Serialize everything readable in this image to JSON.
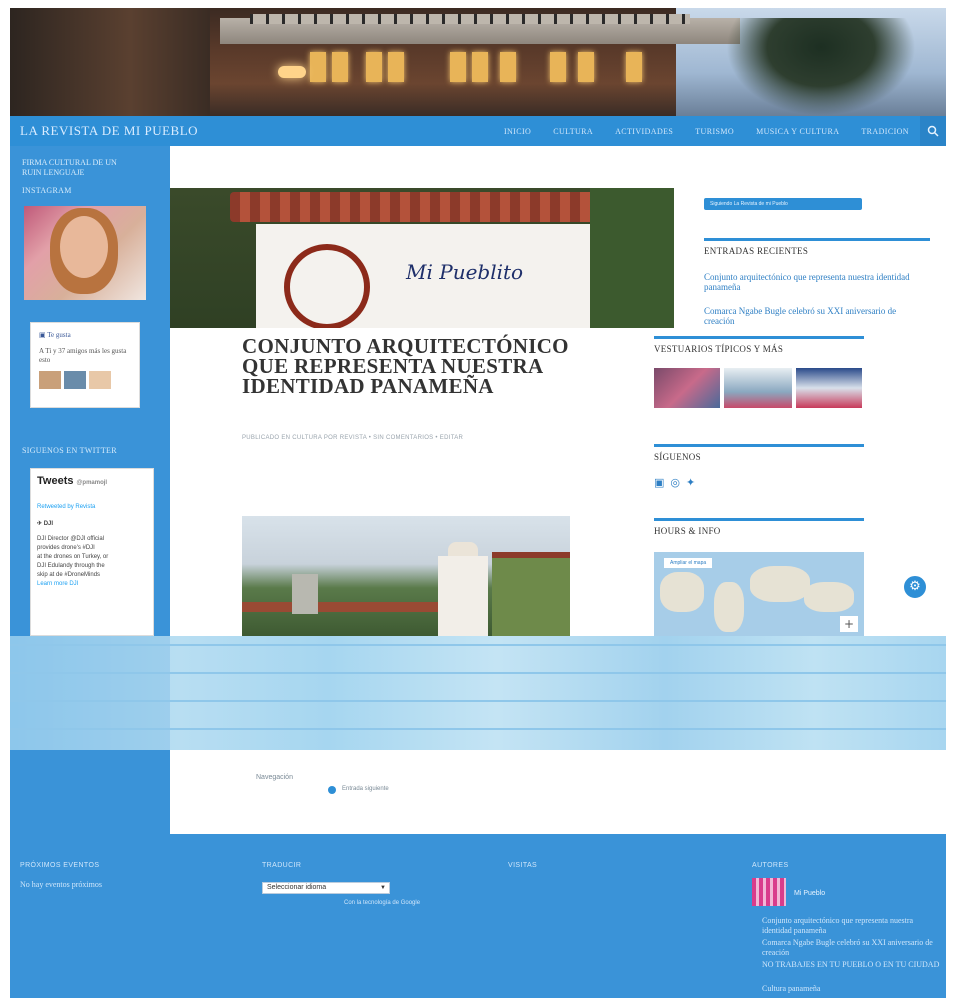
{
  "header": {
    "site_title": "LA REVISTA DE MI PUEBLO",
    "nav": [
      "INICIO",
      "CULTURA",
      "ACTIVIDADES",
      "TURISMO",
      "MUSICA Y CULTURA",
      "TRADICION"
    ],
    "search_icon": "search-icon"
  },
  "left_sidebar": {
    "top_text": "FIRMA CULTURAL DE UN RUIN LENGUAJE",
    "instagram_heading": "INSTAGRAM",
    "facebook": {
      "like_label": "Te gusta",
      "friends_text": "A Ti y 37 amigos más les gusta esto"
    },
    "twitter_heading": "SIGUENOS EN TWITTER",
    "twitter": {
      "title": "Tweets",
      "by": "@pmamojl",
      "retweeted": "Retweeted by Revista",
      "account": "DJI",
      "lines": [
        "DJI Director @DJI official",
        "provides drone's #DJI",
        "at the drones on Turkey, or",
        "DJI Edulandy through the",
        "skip at de #DroneMinds",
        "Learn more DJI"
      ]
    }
  },
  "post": {
    "title": "CONJUNTO ARQUITECTÓNICO QUE REPRESENTA NUESTRA IDENTIDAD PANAMEÑA",
    "meta": "PUBLICADO EN CULTURA POR REVISTA • SIN COMENTARIOS • EDITAR",
    "sign_text": "Mi Pueblito"
  },
  "right_sidebar": {
    "follow_button": "Siguiendo La Revista de mi Pueblo",
    "recent_heading": "ENTRADAS RECIENTES",
    "recent_posts": [
      "Conjunto arquitectónico que representa nuestra identidad panameña",
      "Comarca Ngabe Bugle celebró su XXI aniversario de creación"
    ],
    "gallery_heading": "VESTUARIOS TÍPICOS Y MÁS",
    "social_heading": "SÍGUENOS",
    "social_icons": [
      "facebook-icon",
      "instagram-icon",
      "twitter-icon"
    ],
    "hours_heading": "HOURS & INFO",
    "map_label": "Ampliar el mapa",
    "map_zoom": "+"
  },
  "pagination": {
    "label": "Navegación",
    "next": "Entrada siguiente"
  },
  "footer": {
    "col1_heading": "PRÓXIMOS EVENTOS",
    "col1_text": "No hay eventos próximos",
    "col2_heading": "TRADUCIR",
    "select_value": "Seleccionar idioma",
    "powered_by": "Con la tecnología de Google",
    "col3_heading": "VISITAS",
    "col4_heading": "AUTORES",
    "author_name": "Mi Pueblo",
    "author_posts": [
      "Conjunto arquitectónico que representa nuestra identidad panameña",
      "Comarca Ngabe Bugle celebró su XXI aniversario de creación",
      "NO TRABAJES EN TU PUEBLO O EN TU CIUDAD",
      "Cultura panameña"
    ]
  },
  "colors": {
    "accent": "#2e8fd6",
    "sidebar": "#3a93d8",
    "link": "#2e7fc4"
  }
}
